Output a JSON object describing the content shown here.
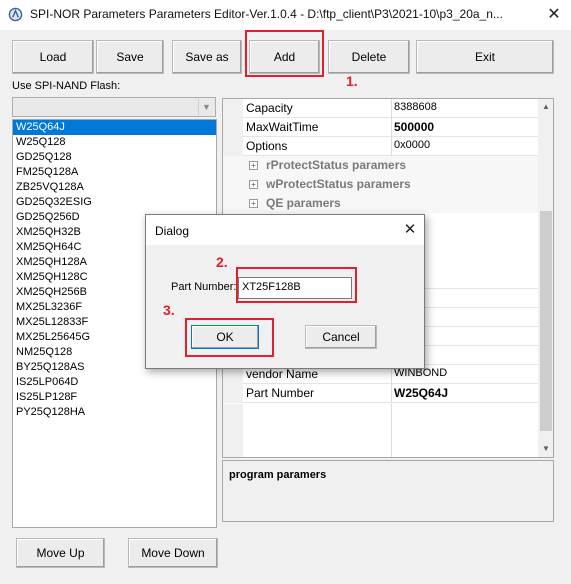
{
  "window": {
    "title": "SPI-NOR Parameters Parameters Editor-Ver.1.0.4 - D:\\ftp_client\\P3\\2021-10\\p3_20a_n...",
    "close_glyph": "✕"
  },
  "toolbar": {
    "load": "Load",
    "save": "Save",
    "save_as": "Save as",
    "add": "Add",
    "delete": "Delete",
    "exit": "Exit"
  },
  "left_panel": {
    "use_nand_label": "Use SPI-NAND Flash:",
    "combo_value": "",
    "chips": [
      "W25Q64J",
      "W25Q128",
      "GD25Q128",
      "FM25Q128A",
      "ZB25VQ128A",
      "GD25Q32ESIG",
      "GD25Q256D",
      "XM25QH32B",
      "XM25QH64C",
      "XM25QH128A",
      "XM25QH128C",
      "XM25QH256B",
      "MX25L3236F",
      "MX25L12833F",
      "MX25L25645G",
      "NM25Q128",
      "BY25Q128AS",
      "IS25LP064D",
      "IS25LP128F",
      "PY25Q128HA"
    ],
    "selected_index": 0,
    "move_up": "Move Up",
    "move_down": "Move Down"
  },
  "props": {
    "capacity": {
      "name": "Capacity",
      "value": "8388608"
    },
    "maxwait": {
      "name": "MaxWaitTime",
      "value": "500000"
    },
    "options": {
      "name": "Options",
      "value": "0x0000"
    },
    "cat_r": "rProtectStatus paramers",
    "cat_w": "wProtectStatus paramers",
    "cat_qe": "QE paramers",
    "partial_val_1": "00000",
    "partial_val_2": "0",
    "partial_val_3": "0",
    "vendor": {
      "name": "vendor Name",
      "value": "WINBOND"
    },
    "partnum": {
      "name": "Part Number",
      "value": "W25Q64J"
    },
    "description_title": "program paramers"
  },
  "dialog": {
    "title": "Dialog",
    "part_label": "Part Number:",
    "part_value": "XT25F128B",
    "ok": "OK",
    "cancel": "Cancel"
  },
  "annotations": {
    "step1": "1.",
    "step2": "2.",
    "step3": "3.",
    "color": "#e0202a"
  },
  "colors": {
    "selection": "#0078d7",
    "background": "#f0f0f0"
  }
}
